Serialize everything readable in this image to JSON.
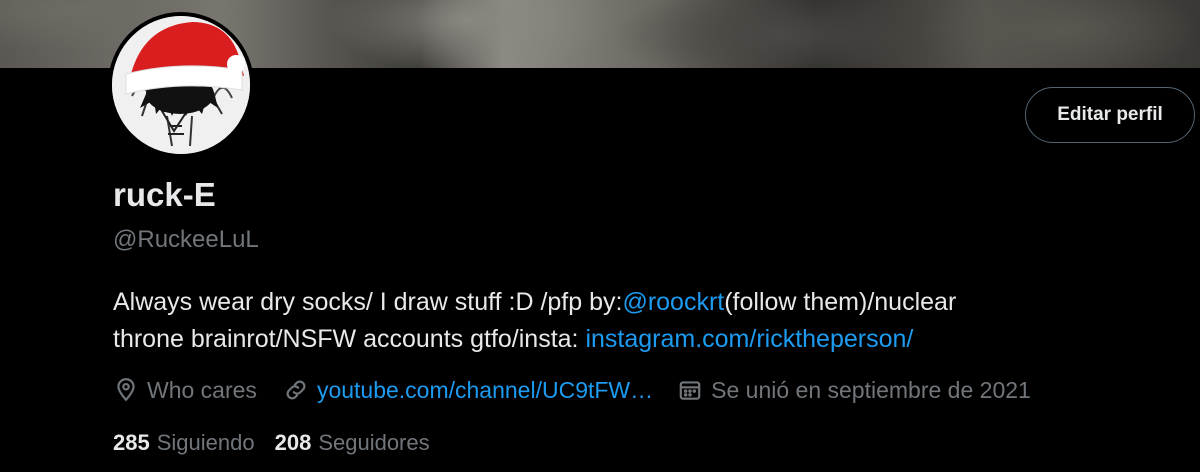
{
  "profile": {
    "display_name": "ruck-E",
    "handle": "@RuckeeLuL"
  },
  "actions": {
    "edit_profile_label": "Editar perfil"
  },
  "bio": {
    "line1_text1": "Always wear dry socks/ I draw stuff :D /pfp by:",
    "line1_mention": "@roockrt",
    "line1_text2": "(follow them)/nuclear",
    "line2_text1": "throne brainrot/NSFW accounts gtfo/insta: ",
    "line2_link": "instagram.com/ricktheperson/"
  },
  "meta": {
    "location": "Who cares",
    "website": "youtube.com/channel/UC9tFW…",
    "joined": "Se unió en septiembre de 2021"
  },
  "stats": {
    "following_count": "285",
    "following_label": "Siguiendo",
    "followers_count": "208",
    "followers_label": "Seguidores"
  },
  "colors": {
    "background": "#000000",
    "text_primary": "#e7e9ea",
    "text_secondary": "#71767b",
    "link": "#1d9bf0",
    "button_border": "#536471"
  },
  "icons": {
    "location": "location-pin-icon",
    "website": "link-icon",
    "joined": "calendar-icon"
  }
}
